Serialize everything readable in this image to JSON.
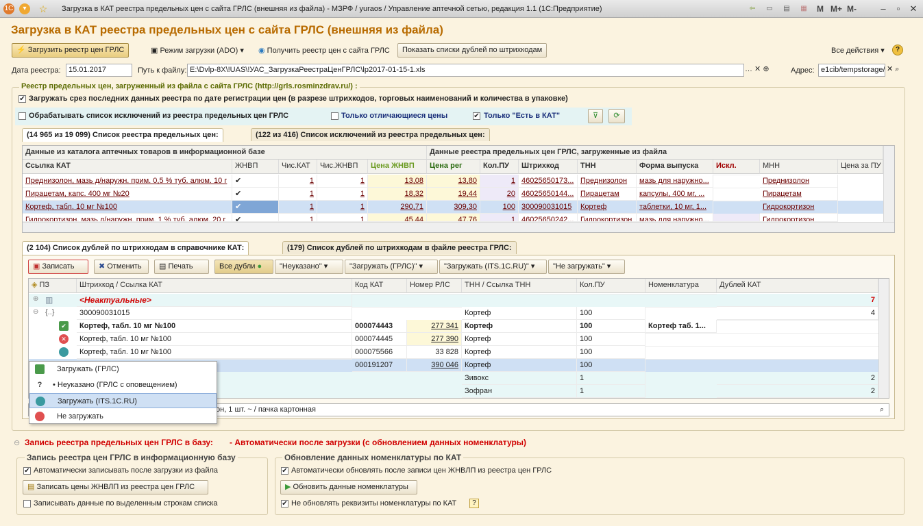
{
  "window": {
    "title": "Загрузка в КАТ реестра предельных цен с сайта ГРЛС (внешняя из файла) - МЗРФ / yuraos / Управление аптечной сетью, редакция 1.1  (1С:Предприятие)",
    "right_tools": [
      "M",
      "M+",
      "M-"
    ]
  },
  "page_title": "Загрузка в КАТ реестра предельных цен с сайта ГРЛС (внешняя из файла)",
  "toolbar": {
    "load_btn": "Загрузить реестр цен ГРЛС",
    "mode": "Режим загрузки (ADO)",
    "get": "Получить реестр цен с сайта ГРЛС",
    "show_dupes": "Показать списки дублей по штрихкодам",
    "all_actions": "Все действия"
  },
  "params": {
    "date_label": "Дата реестра:",
    "date_value": "15.01.2017",
    "path_label": "Путь к файлу:",
    "path_value": "E:\\Dvlp-8X\\!UAS\\!УАС_ЗагрузкаРеестраЦенГРЛС\\lp2017-01-15-1.xls",
    "addr_label": "Адрес:",
    "addr_value": "e1cib/tempstorage/"
  },
  "registry": {
    "group_title": "Реестр предельных цен, загруженный из файла с сайта  ГРЛС  (http://grls.rosminzdrav.ru/) :",
    "chk1": "Загружать срез последних данных реестра по дате регистрации цен (в разрезе штрихкодов, торговых наименований и количества в упаковке)",
    "chk2": "Обрабатывать список исключений из реестра предельных цен ГРЛС",
    "chk3": "Только отличающиеся цены",
    "chk4": "Только \"Есть в КАТ\"",
    "tab1": "(14 965 из 19 099) Список реестра предельных цен:",
    "tab2": "(122 из 416) Список исключений из реестра предельных цен:",
    "band1": "Данные из каталога аптечных товаров в информационной базе",
    "band2": "Данные реестра предельных цен ГРЛС, загруженные из файла",
    "columns": [
      "Ссылка КАТ",
      "ЖНВП",
      "Чис.КАТ",
      "Чис.ЖНВП",
      "Цена ЖНВП",
      "Цена рег",
      "Кол.ПУ",
      "Штрихкод",
      "ТНН",
      "Форма выпуска",
      "Искл.",
      "МНН",
      "Цена за ПУ"
    ],
    "rows": [
      {
        "kat": "Преднизолон, мазь д/наружн. прим. 0,5 % туб. алюм. 10 г",
        "jnvp": "✔",
        "chkat": "1",
        "chjnvp": "1",
        "price_jnvp": "13,08",
        "price_reg": "13,80",
        "pu": "1",
        "barcode": "46025650173...",
        "tnn": "Преднизолон",
        "form": "мазь для наружно...",
        "excl": "",
        "mnn": "Преднизолон"
      },
      {
        "kat": "Пирацетам, капс. 400 мг №20",
        "jnvp": "✔",
        "chkat": "1",
        "chjnvp": "1",
        "price_jnvp": "18,32",
        "price_reg": "19,44",
        "pu": "20",
        "barcode": "46025650144...",
        "tnn": "Пирацетам",
        "form": "капсулы, 400 мг, ...",
        "excl": "",
        "mnn": "Пирацетам"
      },
      {
        "kat": "Кортеф, табл. 10 мг №100",
        "jnvp": "✔",
        "chkat": "1",
        "chjnvp": "1",
        "price_jnvp": "290,71",
        "price_reg": "309,30",
        "pu": "100",
        "barcode": "300090031015",
        "tnn": "Кортеф",
        "form": "таблетки, 10 мг, 1...",
        "excl": "",
        "mnn": "Гидрокортизон"
      },
      {
        "kat": "Гидрокортизон, мазь д/наружн. прим. 1 % туб. алюм. 20 г",
        "jnvp": "✔",
        "chkat": "1",
        "chjnvp": "1",
        "price_jnvp": "45,44",
        "price_reg": "47,76",
        "pu": "1",
        "barcode": "46025650242...",
        "tnn": "Гидрокортизон",
        "form": "мазь для наружно...",
        "excl": "",
        "mnn": "Гидрокортизон"
      }
    ]
  },
  "dupes": {
    "tab1": "(2 104) Список дублей по штрихкодам в справочнике КАТ:",
    "tab2": "(179) Список дублей по штрихкодам в файле реестра ГРЛС:",
    "btn_save": "Записать",
    "btn_cancel": "Отменить",
    "btn_print": "Печать",
    "filters": [
      "Все дубли",
      "\"Неуказано\"",
      "\"Загружать (ГРЛС)\"",
      "\"Загружать (ITS.1C.RU)\"",
      "\"Не загружать\""
    ],
    "columns": [
      "ПЗ",
      "Штрихкод / Ссылка КАТ",
      "Код КАТ",
      "Номер РЛС",
      "ТНН / Ссылка ТНН",
      "Кол.ПУ",
      "Номенклатура",
      "Дублей КАТ"
    ],
    "rows": [
      {
        "name": "<Неактуальные>",
        "code": "",
        "rls": "",
        "tnn": "",
        "pu": "",
        "nom": "",
        "count": "7"
      },
      {
        "name": "300090031015",
        "code": "",
        "rls": "",
        "tnn": "Кортеф",
        "pu": "100",
        "nom": "",
        "count": "4"
      },
      {
        "name": "Кортеф, табл. 10 мг №100",
        "code": "000074443",
        "rls": "277 341",
        "tnn": "Кортеф",
        "pu": "100",
        "nom": "Кортеф таб. 1...",
        "count": ""
      },
      {
        "name": "Кортеф, табл. 10 мг №100",
        "code": "000074445",
        "rls": "277 390",
        "tnn": "Кортеф",
        "pu": "100",
        "nom": "",
        "count": ""
      },
      {
        "name": "Кортеф, табл. 10 мг №100",
        "code": "000075566",
        "rls": "33 828",
        "tnn": "Кортеф",
        "pu": "100",
        "nom": "",
        "count": ""
      },
      {
        "name": "",
        "code": "000191207",
        "rls": "390 046",
        "tnn": "Кортеф",
        "pu": "100",
        "nom": "",
        "count": ""
      },
      {
        "name": "",
        "code": "",
        "rls": "",
        "tnn": "Зивокс",
        "pu": "1",
        "nom": "",
        "count": "2"
      },
      {
        "name": "",
        "code": "",
        "rls": "",
        "tnn": "Зофран",
        "pu": "1",
        "nom": "",
        "count": "2"
      }
    ],
    "footer_text": "он, 1 шт. ~ / пачка картонная"
  },
  "popup": {
    "items": [
      "Загружать (ГРЛС)",
      "• Неуказано (ГРЛС с оповещением)",
      "Загружать (ITS.1C.RU)",
      "Не загружать"
    ]
  },
  "write": {
    "label": "Запись реестра предельных цен ГРЛС в базу:",
    "value": "- Автоматически после загрузки (с обновлением данных номенклатуры)",
    "left_group": "Запись реестра цен ГРЛС в информационную базу",
    "left_chk1": "Автоматически записывать после загрузки из файла",
    "left_btn": "Записать цены ЖНВЛП из реестра цен ГРЛС",
    "left_chk2": "Записывать данные по выделенным строкам списка",
    "right_group": "Обновление данных номенклатуры по КАТ",
    "right_chk1": "Автоматически обновлять после записи цен ЖНВЛП из реестра цен ГРЛС",
    "right_btn": "Обновить данные номенклатуры",
    "right_chk2": "Не обновлять реквизиты номенклатуры по КАТ",
    "help": "?"
  }
}
